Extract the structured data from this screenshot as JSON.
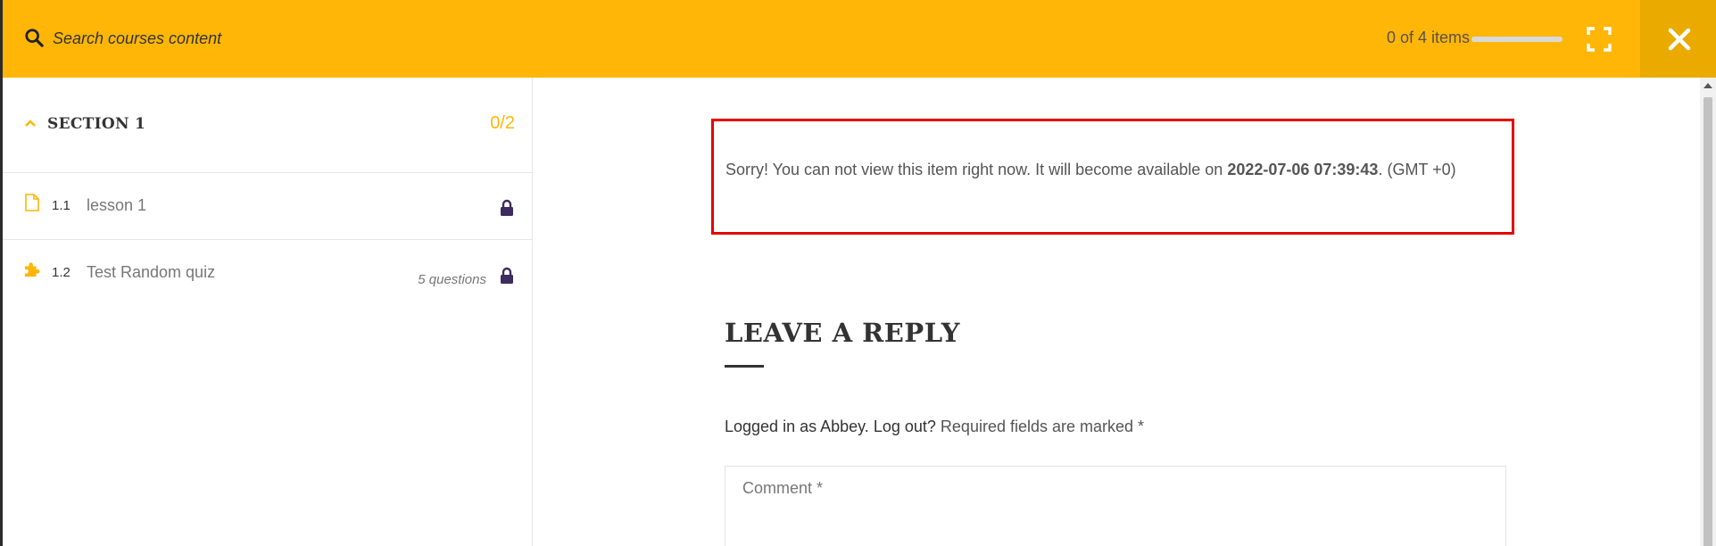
{
  "header": {
    "search_placeholder": "Search courses content",
    "progress_text": "0 of 4 items",
    "progress_fraction": 0,
    "accent_color": "#ffb606",
    "icons": [
      "search-icon",
      "fullscreen-icon",
      "close-icon"
    ]
  },
  "sidebar": {
    "section": {
      "title": "SECTION 1",
      "count": "0/2",
      "icon": "chevron-up-icon"
    },
    "items": [
      {
        "number": "1.1",
        "title": "lesson 1",
        "meta": "",
        "type_icon": "file-icon",
        "status_icon": "lock-icon"
      },
      {
        "number": "1.2",
        "title": "Test Random quiz",
        "meta": "5 questions",
        "type_icon": "puzzle-icon",
        "status_icon": "lock-icon"
      }
    ]
  },
  "content": {
    "notice": {
      "text_before": "Sorry! You can not view this item right now. It will become available on",
      "date": "2022-07-06 07:39:43",
      "text_after": ". (GMT +0)"
    },
    "reply": {
      "title": "LEAVE A REPLY",
      "logged_in_prefix": "Logged in as Abbey.",
      "logout_label": "Log out?",
      "required_note": "Required fields are marked *",
      "comment_placeholder": "Comment *"
    }
  }
}
